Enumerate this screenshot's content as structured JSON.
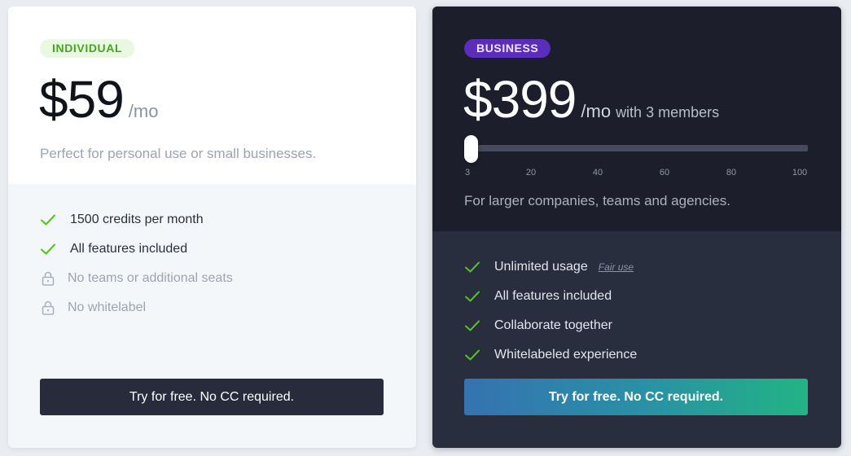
{
  "individual": {
    "badge": "INDIVIDUAL",
    "price": "$59",
    "unit": "/mo",
    "description": "Perfect for personal use or small businesses.",
    "features": [
      {
        "text": "1500 credits per month",
        "included": true
      },
      {
        "text": "All features included",
        "included": true
      },
      {
        "text": "No teams or additional seats",
        "included": false
      },
      {
        "text": "No whitelabel",
        "included": false
      }
    ],
    "cta": "Try for free. No CC required."
  },
  "business": {
    "badge": "BUSINESS",
    "price": "$399",
    "unit": "/mo",
    "members_text": "with 3 members",
    "slider": {
      "value": 3,
      "min": 3,
      "max": 100,
      "ticks": [
        "3",
        "20",
        "40",
        "60",
        "80",
        "100"
      ]
    },
    "description": "For larger companies, teams and agencies.",
    "features": [
      {
        "text": "Unlimited usage",
        "included": true,
        "link": "Fair use"
      },
      {
        "text": "All features included",
        "included": true
      },
      {
        "text": "Collaborate together",
        "included": true
      },
      {
        "text": "Whitelabeled experience",
        "included": true
      }
    ],
    "cta": "Try for free. No CC required."
  },
  "colors": {
    "check": "#52c41a",
    "lock": "#aab2c2",
    "business_badge": "#5a2dbd",
    "individual_badge": "#e9f8e1"
  },
  "icons": {
    "included": "check-icon",
    "excluded": "lock-icon"
  }
}
